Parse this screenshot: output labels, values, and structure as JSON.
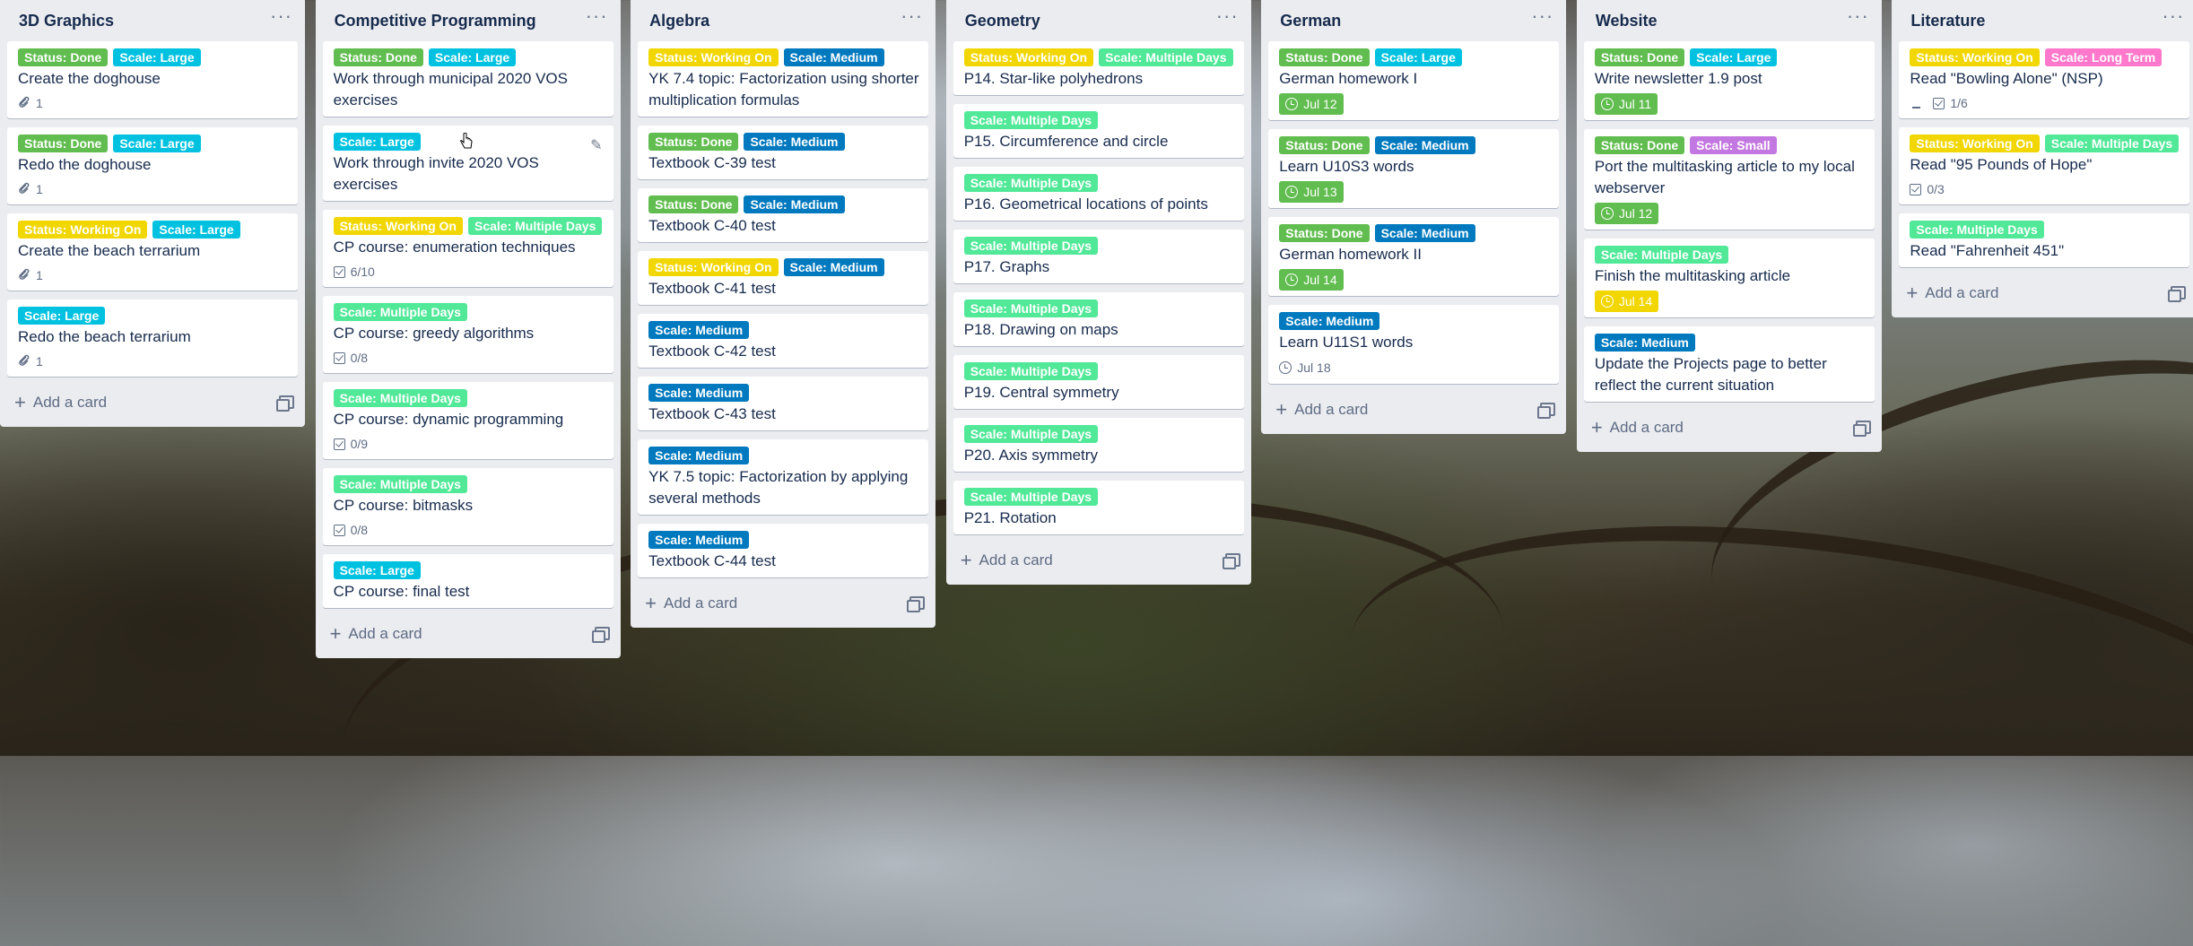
{
  "colors": {
    "green": "#61bd4f",
    "sky": "#00c2e0",
    "yellow": "#f2d600",
    "blue": "#0079bf",
    "lime": "#51e898",
    "purple": "#c377e0",
    "pink": "#ff78cb"
  },
  "ui": {
    "add_card": "Add a card",
    "menu": "···"
  },
  "lists": [
    {
      "title": "3D Graphics",
      "cards": [
        {
          "labels": [
            {
              "text": "Status: Done",
              "color": "green"
            },
            {
              "text": "Scale: Large",
              "color": "sky"
            }
          ],
          "title": "Create the doghouse",
          "attachments": "1"
        },
        {
          "labels": [
            {
              "text": "Status: Done",
              "color": "green"
            },
            {
              "text": "Scale: Large",
              "color": "sky"
            }
          ],
          "title": "Redo the doghouse",
          "attachments": "1"
        },
        {
          "labels": [
            {
              "text": "Status: Working On",
              "color": "yellow"
            },
            {
              "text": "Scale: Large",
              "color": "sky"
            }
          ],
          "title": "Create the beach terrarium",
          "attachments": "1"
        },
        {
          "labels": [
            {
              "text": "Scale: Large",
              "color": "sky"
            }
          ],
          "title": "Redo the beach terrarium",
          "attachments": "1"
        }
      ]
    },
    {
      "title": "Competitive Programming",
      "cards": [
        {
          "labels": [
            {
              "text": "Status: Done",
              "color": "green"
            },
            {
              "text": "Scale: Large",
              "color": "sky"
            }
          ],
          "title": "Work through municipal 2020 VOS exercises"
        },
        {
          "labels": [
            {
              "text": "Scale: Large",
              "color": "sky"
            }
          ],
          "title": "Work through invite 2020 VOS exercises",
          "hover": true
        },
        {
          "labels": [
            {
              "text": "Status: Working On",
              "color": "yellow"
            },
            {
              "text": "Scale: Multiple Days",
              "color": "lime"
            }
          ],
          "title": "CP course: enumeration techniques",
          "checklist": "6/10"
        },
        {
          "labels": [
            {
              "text": "Scale: Multiple Days",
              "color": "lime"
            }
          ],
          "title": "CP course: greedy algorithms",
          "checklist": "0/8"
        },
        {
          "labels": [
            {
              "text": "Scale: Multiple Days",
              "color": "lime"
            }
          ],
          "title": "CP course: dynamic programming",
          "checklist": "0/9"
        },
        {
          "labels": [
            {
              "text": "Scale: Multiple Days",
              "color": "lime"
            }
          ],
          "title": "CP course: bitmasks",
          "checklist": "0/8"
        },
        {
          "labels": [
            {
              "text": "Scale: Large",
              "color": "sky"
            }
          ],
          "title": "CP course: final test"
        }
      ]
    },
    {
      "title": "Algebra",
      "cards": [
        {
          "labels": [
            {
              "text": "Status: Working On",
              "color": "yellow"
            },
            {
              "text": "Scale: Medium",
              "color": "blue"
            }
          ],
          "title": "YK 7.4 topic: Factorization using shorter multiplication formulas"
        },
        {
          "labels": [
            {
              "text": "Status: Done",
              "color": "green"
            },
            {
              "text": "Scale: Medium",
              "color": "blue"
            }
          ],
          "title": "Textbook C-39 test"
        },
        {
          "labels": [
            {
              "text": "Status: Done",
              "color": "green"
            },
            {
              "text": "Scale: Medium",
              "color": "blue"
            }
          ],
          "title": "Textbook C-40 test"
        },
        {
          "labels": [
            {
              "text": "Status: Working On",
              "color": "yellow"
            },
            {
              "text": "Scale: Medium",
              "color": "blue"
            }
          ],
          "title": "Textbook C-41 test"
        },
        {
          "labels": [
            {
              "text": "Scale: Medium",
              "color": "blue"
            }
          ],
          "title": "Textbook C-42 test"
        },
        {
          "labels": [
            {
              "text": "Scale: Medium",
              "color": "blue"
            }
          ],
          "title": "Textbook C-43 test"
        },
        {
          "labels": [
            {
              "text": "Scale: Medium",
              "color": "blue"
            }
          ],
          "title": "YK 7.5 topic: Factorization by applying several methods"
        },
        {
          "labels": [
            {
              "text": "Scale: Medium",
              "color": "blue"
            }
          ],
          "title": "Textbook C-44 test"
        }
      ]
    },
    {
      "title": "Geometry",
      "cards": [
        {
          "labels": [
            {
              "text": "Status: Working On",
              "color": "yellow"
            },
            {
              "text": "Scale: Multiple Days",
              "color": "lime"
            }
          ],
          "title": "P14. Star-like polyhedrons"
        },
        {
          "labels": [
            {
              "text": "Scale: Multiple Days",
              "color": "lime"
            }
          ],
          "title": "P15. Circumference and circle"
        },
        {
          "labels": [
            {
              "text": "Scale: Multiple Days",
              "color": "lime"
            }
          ],
          "title": "P16. Geometrical locations of points"
        },
        {
          "labels": [
            {
              "text": "Scale: Multiple Days",
              "color": "lime"
            }
          ],
          "title": "P17. Graphs"
        },
        {
          "labels": [
            {
              "text": "Scale: Multiple Days",
              "color": "lime"
            }
          ],
          "title": "P18. Drawing on maps"
        },
        {
          "labels": [
            {
              "text": "Scale: Multiple Days",
              "color": "lime"
            }
          ],
          "title": "P19. Central symmetry"
        },
        {
          "labels": [
            {
              "text": "Scale: Multiple Days",
              "color": "lime"
            }
          ],
          "title": "P20. Axis symmetry"
        },
        {
          "labels": [
            {
              "text": "Scale: Multiple Days",
              "color": "lime"
            }
          ],
          "title": "P21. Rotation"
        }
      ]
    },
    {
      "title": "German",
      "cards": [
        {
          "labels": [
            {
              "text": "Status: Done",
              "color": "green"
            },
            {
              "text": "Scale: Large",
              "color": "sky"
            }
          ],
          "title": "German homework I",
          "due": {
            "text": "Jul 12",
            "style": "green"
          }
        },
        {
          "labels": [
            {
              "text": "Status: Done",
              "color": "green"
            },
            {
              "text": "Scale: Medium",
              "color": "blue"
            }
          ],
          "title": "Learn U10S3 words",
          "due": {
            "text": "Jul 13",
            "style": "green"
          }
        },
        {
          "labels": [
            {
              "text": "Status: Done",
              "color": "green"
            },
            {
              "text": "Scale: Medium",
              "color": "blue"
            }
          ],
          "title": "German homework II",
          "due": {
            "text": "Jul 14",
            "style": "green"
          }
        },
        {
          "labels": [
            {
              "text": "Scale: Medium",
              "color": "blue"
            }
          ],
          "title": "Learn U11S1 words",
          "due": {
            "text": "Jul 18",
            "style": "plain"
          }
        }
      ]
    },
    {
      "title": "Website",
      "cards": [
        {
          "labels": [
            {
              "text": "Status: Done",
              "color": "green"
            },
            {
              "text": "Scale: Large",
              "color": "sky"
            }
          ],
          "title": "Write newsletter 1.9 post",
          "due": {
            "text": "Jul 11",
            "style": "green"
          }
        },
        {
          "labels": [
            {
              "text": "Status: Done",
              "color": "green"
            },
            {
              "text": "Scale: Small",
              "color": "purple"
            }
          ],
          "title": "Port the multitasking article to my local webserver",
          "due": {
            "text": "Jul 12",
            "style": "green"
          }
        },
        {
          "labels": [
            {
              "text": "Scale: Multiple Days",
              "color": "lime"
            }
          ],
          "title": "Finish the multitasking article",
          "due": {
            "text": "Jul 14",
            "style": "yellow"
          }
        },
        {
          "labels": [
            {
              "text": "Scale: Medium",
              "color": "blue"
            }
          ],
          "title": "Update the Projects page to better reflect the current situation"
        }
      ]
    },
    {
      "title": "Literature",
      "cards": [
        {
          "labels": [
            {
              "text": "Status: Working On",
              "color": "yellow"
            },
            {
              "text": "Scale: Long Term",
              "color": "pink"
            }
          ],
          "title": "Read \"Bowling Alone\" (NSP)",
          "description": true,
          "checklist": "1/6"
        },
        {
          "labels": [
            {
              "text": "Status: Working On",
              "color": "yellow"
            },
            {
              "text": "Scale: Multiple Days",
              "color": "lime"
            }
          ],
          "title": "Read \"95 Pounds of Hope\"",
          "checklist": "0/3"
        },
        {
          "labels": [
            {
              "text": "Scale: Multiple Days",
              "color": "lime"
            }
          ],
          "title": "Read \"Fahrenheit 451\""
        }
      ]
    }
  ]
}
